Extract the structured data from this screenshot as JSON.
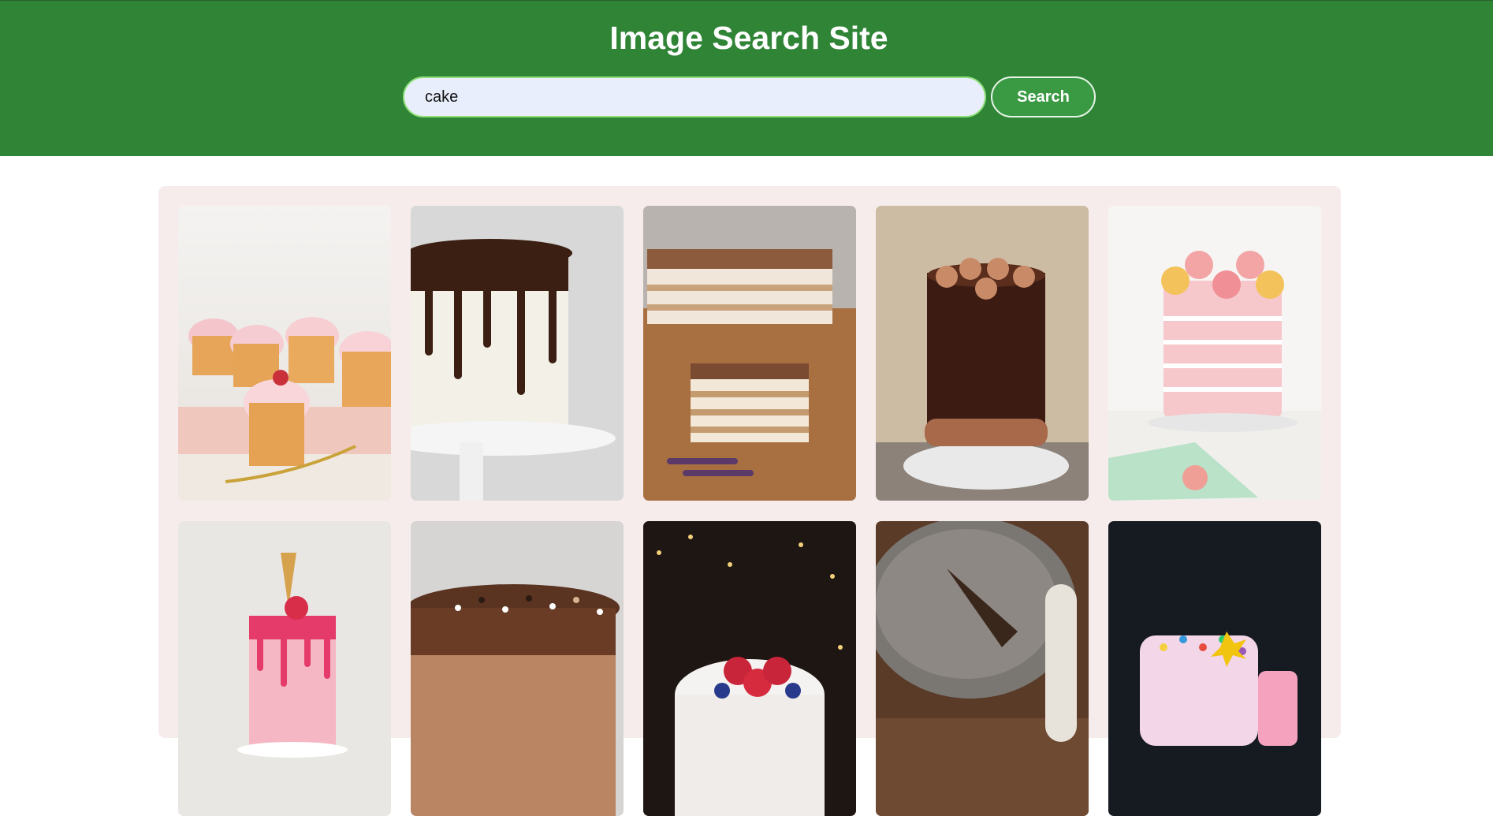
{
  "header": {
    "title": "Image Search Site",
    "search_value": "cake",
    "search_button_label": "Search"
  },
  "results": [
    {
      "name": "image-pink-cupcakes"
    },
    {
      "name": "image-white-cake-chocolate-drip"
    },
    {
      "name": "image-layered-tiramisu-slice"
    },
    {
      "name": "image-chocolate-drip-cake-rosettes"
    },
    {
      "name": "image-pink-macaron-cake"
    },
    {
      "name": "image-pink-drip-cake-ice-cream-cone"
    },
    {
      "name": "image-chocolate-cake-sprinkles"
    },
    {
      "name": "image-white-cake-berries"
    },
    {
      "name": "image-sugar-dusted-chocolate-cake"
    },
    {
      "name": "image-rainbow-sprinkle-cake"
    }
  ]
}
